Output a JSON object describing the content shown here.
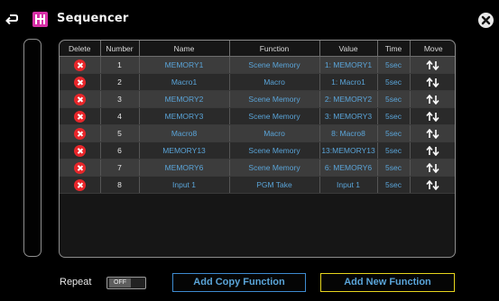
{
  "header": {
    "title": "Sequencer"
  },
  "table": {
    "columns": [
      "Delete",
      "Number",
      "Name",
      "Function",
      "Value",
      "Time",
      "Move"
    ],
    "rows": [
      {
        "number": "1",
        "name": "MEMORY1",
        "function": "Scene Memory",
        "value": "1: MEMORY1",
        "time": "5sec"
      },
      {
        "number": "2",
        "name": "Macro1",
        "function": "Macro",
        "value": "1:  Macro1",
        "time": "5sec"
      },
      {
        "number": "3",
        "name": "MEMORY2",
        "function": "Scene Memory",
        "value": "2: MEMORY2",
        "time": "5sec"
      },
      {
        "number": "4",
        "name": "MEMORY3",
        "function": "Scene Memory",
        "value": "3: MEMORY3",
        "time": "5sec"
      },
      {
        "number": "5",
        "name": "Macro8",
        "function": "Macro",
        "value": "8:  Macro8",
        "time": "5sec"
      },
      {
        "number": "6",
        "name": "MEMORY13",
        "function": "Scene Memory",
        "value": "13:MEMORY13",
        "time": "5sec"
      },
      {
        "number": "7",
        "name": "MEMORY6",
        "function": "Scene Memory",
        "value": "6: MEMORY6",
        "time": "5sec"
      },
      {
        "number": "8",
        "name": "Input 1",
        "function": "PGM Take",
        "value": "Input 1",
        "time": "5sec"
      }
    ]
  },
  "footer": {
    "repeat_label": "Repeat",
    "repeat_state": "OFF",
    "add_copy_label": "Add Copy Function",
    "add_new_label": "Add New Function"
  },
  "icons": {
    "back": "back-arrow-icon",
    "logo": "sequencer-logo-icon",
    "close": "close-icon",
    "delete": "delete-icon",
    "move": "move-up-down-icon"
  },
  "colors": {
    "accent_blue": "#5aa4d8",
    "delete_red": "#e8262a",
    "logo_magenta": "#d62fa6",
    "new_button_border": "#e6d51d"
  }
}
